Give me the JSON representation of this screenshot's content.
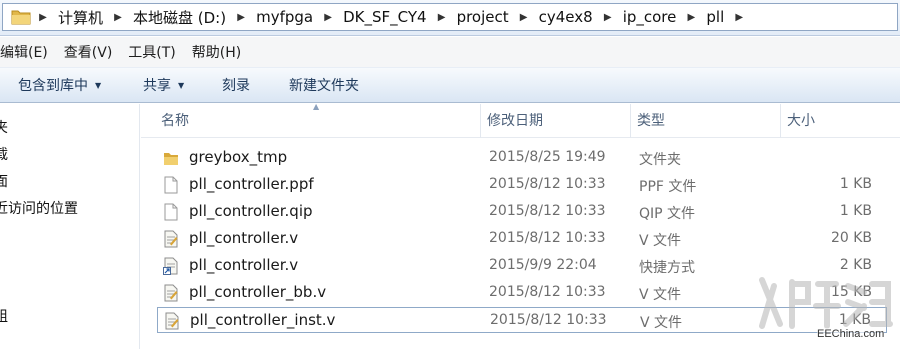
{
  "address": {
    "crumbs": [
      "计算机",
      "本地磁盘 (D:)",
      "myfpga",
      "DK_SF_CY4",
      "project",
      "cy4ex8",
      "ip_core",
      "pll"
    ]
  },
  "menu": [
    "编辑(E)",
    "查看(V)",
    "工具(T)",
    "帮助(H)"
  ],
  "commands": {
    "include": "包含到库中",
    "share": "共享",
    "burn": "刻录",
    "new_folder": "新建文件夹"
  },
  "nav": [
    "夹",
    "载",
    "面",
    "近访问的位置",
    "组"
  ],
  "columns": {
    "name": "名称",
    "date": "修改日期",
    "type": "类型",
    "size": "大小"
  },
  "files": [
    {
      "name": "greybox_tmp",
      "date": "2015/8/25 19:49",
      "type": "文件夹",
      "size": "",
      "icon": "folder-icon"
    },
    {
      "name": "pll_controller.ppf",
      "date": "2015/8/12 10:33",
      "type": "PPF 文件",
      "size": "1 KB",
      "icon": "blank-file-icon"
    },
    {
      "name": "pll_controller.qip",
      "date": "2015/8/12 10:33",
      "type": "QIP 文件",
      "size": "1 KB",
      "icon": "blank-file-icon"
    },
    {
      "name": "pll_controller.v",
      "date": "2015/8/12 10:33",
      "type": "V 文件",
      "size": "20 KB",
      "icon": "text-file-icon"
    },
    {
      "name": "pll_controller.v",
      "date": "2015/9/9 22:04",
      "type": "快捷方式",
      "size": "2 KB",
      "icon": "shortcut-file-icon"
    },
    {
      "name": "pll_controller_bb.v",
      "date": "2015/8/12 10:33",
      "type": "V 文件",
      "size": "15 KB",
      "icon": "text-file-icon"
    },
    {
      "name": "pll_controller_inst.v",
      "date": "2015/8/12 10:33",
      "type": "V 文件",
      "size": "1 KB",
      "icon": "text-file-icon"
    }
  ],
  "watermark": {
    "site": "EEChina.com"
  },
  "colors": {
    "folder": "#e8c35a",
    "header_text": "#4c607a",
    "command_text": "#1e395b",
    "focus_border": "#8fa9c8"
  }
}
